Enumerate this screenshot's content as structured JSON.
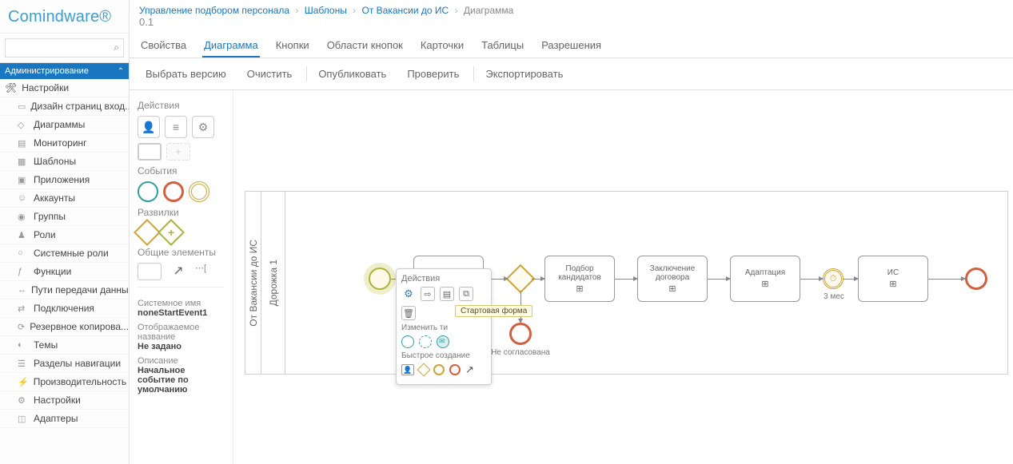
{
  "logo": "Comindware",
  "search_placeholder": "",
  "sidebar": {
    "section": "Администрирование",
    "group": "Настройки",
    "items": [
      {
        "label": "Дизайн страниц вход..."
      },
      {
        "label": "Диаграммы"
      },
      {
        "label": "Мониторинг"
      },
      {
        "label": "Шаблоны"
      },
      {
        "label": "Приложения"
      },
      {
        "label": "Аккаунты"
      },
      {
        "label": "Группы"
      },
      {
        "label": "Роли"
      },
      {
        "label": "Системные роли"
      },
      {
        "label": "Функции"
      },
      {
        "label": "Пути передачи данных"
      },
      {
        "label": "Подключения"
      },
      {
        "label": "Резервное копирова..."
      },
      {
        "label": "Темы"
      },
      {
        "label": "Разделы навигации"
      },
      {
        "label": "Производительность"
      },
      {
        "label": "Настройки"
      },
      {
        "label": "Адаптеры"
      }
    ]
  },
  "breadcrumbs": [
    {
      "label": "Управление подбором персонала"
    },
    {
      "label": "Шаблоны"
    },
    {
      "label": "От Вакансии до ИС"
    },
    {
      "label": "Диаграмма"
    }
  ],
  "version": "0.1",
  "tabs": [
    {
      "label": "Свойства"
    },
    {
      "label": "Диаграмма"
    },
    {
      "label": "Кнопки"
    },
    {
      "label": "Области кнопок"
    },
    {
      "label": "Карточки"
    },
    {
      "label": "Таблицы"
    },
    {
      "label": "Разрешения"
    }
  ],
  "toolbar": [
    {
      "label": "Выбрать версию"
    },
    {
      "label": "Очистить"
    },
    {
      "label": "Опубликовать"
    },
    {
      "label": "Проверить"
    },
    {
      "label": "Экспортировать"
    }
  ],
  "palette": {
    "actions_label": "Действия",
    "events_label": "События",
    "gateways_label": "Развилки",
    "common_label": "Общие элементы"
  },
  "props": {
    "sysname_label": "Системное имя",
    "sysname_value": "noneStartEvent1",
    "displayname_label": "Отображаемое название",
    "displayname_value": "Не задано",
    "desc_label": "Описание",
    "desc_value": "Начальное событие по умолчанию"
  },
  "pool": {
    "pool_label": "От Вакансии до ИС",
    "lane_label": "Дорожка 1"
  },
  "diagram": {
    "tasks": [
      {
        "label": ""
      },
      {
        "label": "Подбор кандидатов"
      },
      {
        "label": "Заключение договора"
      },
      {
        "label": "Адаптация"
      },
      {
        "label": "ИС"
      }
    ],
    "timer_label": "3 мес",
    "end2_label": "Не согласована"
  },
  "context_menu": {
    "title": "Действия",
    "change_type": "Изменить ти",
    "quick_create": "Быстрое создание",
    "tooltip": "Стартовая форма"
  }
}
